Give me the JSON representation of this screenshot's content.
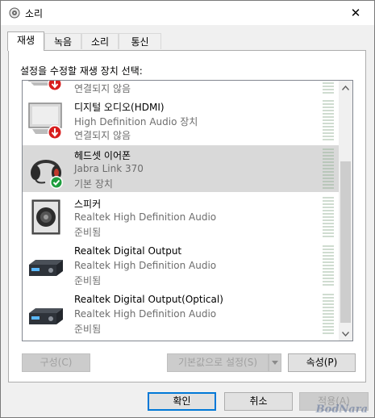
{
  "window": {
    "title": "소리",
    "close_symbol": "✕"
  },
  "tabs": [
    {
      "label": "재생",
      "active": true
    },
    {
      "label": "녹음",
      "active": false
    },
    {
      "label": "소리",
      "active": false
    },
    {
      "label": "통신",
      "active": false
    }
  ],
  "prompt": "설정을 수정할 재생 장치 선택:",
  "devices": [
    {
      "name": "",
      "desc": "",
      "status": "연결되지 않음",
      "icon": "monitor-disconnected-icon",
      "selected": false
    },
    {
      "name": "디지털 오디오(HDMI)",
      "desc": "High Definition Audio 장치",
      "status": "연결되지 않음",
      "icon": "monitor-disconnected-icon",
      "selected": false
    },
    {
      "name": "헤드셋 이어폰",
      "desc": "Jabra Link 370",
      "status": "기본 장치",
      "icon": "headset-default-icon",
      "selected": true
    },
    {
      "name": "스피커",
      "desc": "Realtek High Definition Audio",
      "status": "준비됨",
      "icon": "speaker-icon",
      "selected": false
    },
    {
      "name": "Realtek Digital Output",
      "desc": "Realtek High Definition Audio",
      "status": "준비됨",
      "icon": "digital-receiver-icon",
      "selected": false
    },
    {
      "name": "Realtek Digital Output(Optical)",
      "desc": "Realtek High Definition Audio",
      "status": "준비됨",
      "icon": "digital-receiver-icon",
      "selected": false
    }
  ],
  "buttons": {
    "configure": "구성(C)",
    "set_default": "기본값으로 설정(S)",
    "properties": "속성(P)",
    "ok": "확인",
    "cancel": "취소",
    "apply": "적용(A)"
  },
  "watermark": "BodNara"
}
